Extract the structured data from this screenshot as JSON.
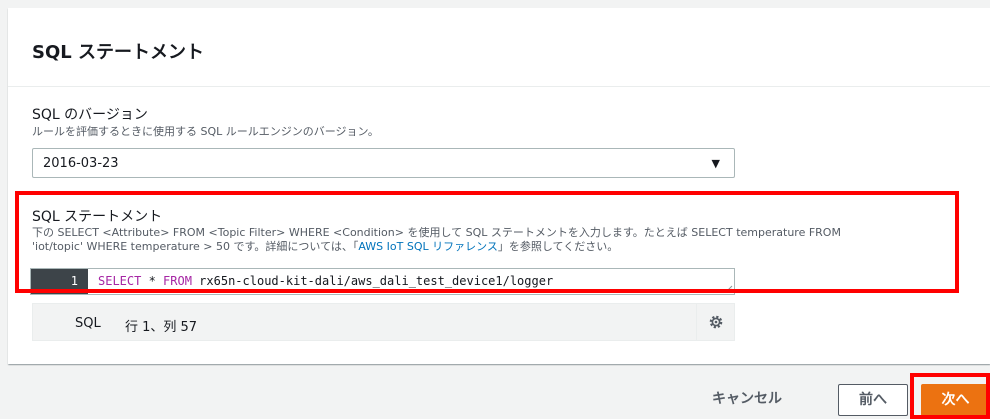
{
  "section": {
    "title": "SQL ステートメント"
  },
  "sql_version": {
    "label": "SQL のバージョン",
    "description": "ルールを評価するときに使用する SQL ルールエンジンのバージョン。",
    "selected_value": "2016-03-23"
  },
  "sql_statement": {
    "label": "SQL ステートメント",
    "description_line1": "下の SELECT <Attribute> FROM <Topic Filter> WHERE <Condition> を使用して SQL ステートメントを入力します。たとえば SELECT temperature FROM",
    "description_line2_prefix": "'iot/topic' WHERE temperature > 50 です。詳細については、「",
    "description_link": "AWS IoT SQL リファレンス",
    "description_line2_suffix": "」を参照してください。",
    "line_number": "1",
    "code_select": "SELECT",
    "code_star": " * ",
    "code_from": "FROM",
    "code_topic": " rx65n-cloud-kit-dali/aws_dali_test_device1/logger"
  },
  "status_bar": {
    "mode": "SQL",
    "position": "行 1、列 57"
  },
  "footer": {
    "cancel_label": "キャンセル",
    "prev_label": "前へ",
    "next_label": "次へ"
  },
  "colors": {
    "primary_button": "#ec7211",
    "highlight_border": "#ff0000",
    "link": "#0073bb"
  }
}
